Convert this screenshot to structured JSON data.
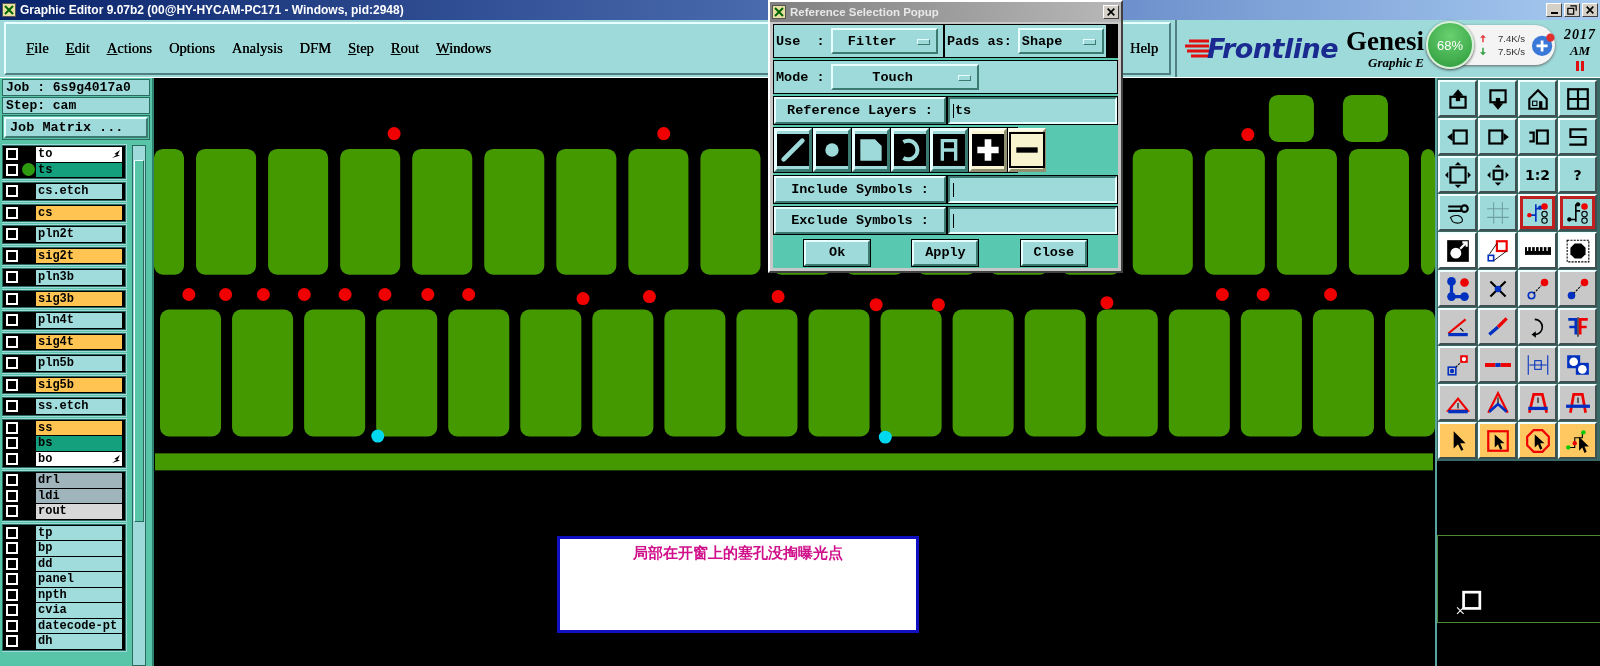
{
  "window": {
    "title": "Graphic Editor 9.07b2 (00@HY-HYCAM-PC171 - Windows, pid:2948)"
  },
  "menu": [
    {
      "label": "File",
      "mnemonic": true
    },
    {
      "label": "Edit",
      "mnemonic": true
    },
    {
      "label": "Actions",
      "mnemonic": true
    },
    {
      "label": "Options",
      "mnemonic": false
    },
    {
      "label": "Analysis",
      "mnemonic": false
    },
    {
      "label": "DFM",
      "mnemonic": false
    },
    {
      "label": "Step",
      "mnemonic": true
    },
    {
      "label": "Rout",
      "mnemonic": true
    },
    {
      "label": "Windows",
      "mnemonic": true
    }
  ],
  "help": "Help",
  "brand": {
    "logo": "Frontline",
    "product": "Genesi",
    "subtitle": "Graphic E",
    "year": "2017",
    "ampm": "AM"
  },
  "tray": {
    "percent": "68%",
    "upload": "7.4K/s",
    "download": "7.5K/s"
  },
  "job": "Job : 6s9g4017a0",
  "step": "Step: cam",
  "job_matrix": "Job Matrix ...",
  "layer_groups": [
    [
      {
        "name": "to",
        "color": "#ffffff",
        "checked": false,
        "work": false,
        "flag": true
      },
      {
        "name": "ts",
        "color": "#14a07c",
        "checked": false,
        "work": true,
        "flag": false
      }
    ],
    [
      {
        "name": "cs.etch",
        "color": "#a0dcdc",
        "checked": false,
        "work": false,
        "flag": false
      }
    ],
    [
      {
        "name": "cs",
        "color": "#ffc452",
        "checked": false,
        "work": false,
        "flag": false
      }
    ],
    [
      {
        "name": "pln2t",
        "color": "#a0dcdc",
        "checked": false,
        "work": false,
        "flag": false
      }
    ],
    [
      {
        "name": "sig2t",
        "color": "#ffc452",
        "checked": false,
        "work": false,
        "flag": false
      }
    ],
    [
      {
        "name": "pln3b",
        "color": "#a0dcdc",
        "checked": false,
        "work": false,
        "flag": false
      }
    ],
    [
      {
        "name": "sig3b",
        "color": "#ffc452",
        "checked": false,
        "work": false,
        "flag": false
      }
    ],
    [
      {
        "name": "pln4t",
        "color": "#a0dcdc",
        "checked": false,
        "work": false,
        "flag": false
      }
    ],
    [
      {
        "name": "sig4t",
        "color": "#ffc452",
        "checked": false,
        "work": false,
        "flag": false
      }
    ],
    [
      {
        "name": "pln5b",
        "color": "#a0dcdc",
        "checked": false,
        "work": false,
        "flag": false
      }
    ],
    [
      {
        "name": "sig5b",
        "color": "#ffc452",
        "checked": false,
        "work": false,
        "flag": false
      }
    ],
    [
      {
        "name": "ss.etch",
        "color": "#a0dcdc",
        "checked": false,
        "work": false,
        "flag": false
      }
    ],
    [
      {
        "name": "ss",
        "color": "#ffc452",
        "checked": false,
        "work": false,
        "flag": false
      },
      {
        "name": "bs",
        "color": "#14a07c",
        "checked": false,
        "work": false,
        "flag": false
      },
      {
        "name": "bo",
        "color": "#ffffff",
        "checked": false,
        "work": false,
        "flag": true
      }
    ],
    [
      {
        "name": "drl",
        "color": "#a0b4bc",
        "checked": false,
        "work": false,
        "flag": false
      },
      {
        "name": "ldi",
        "color": "#a0b4bc",
        "checked": false,
        "work": false,
        "flag": false
      },
      {
        "name": "rout",
        "color": "#d8d8d8",
        "checked": false,
        "work": false,
        "flag": false
      }
    ],
    [
      {
        "name": "tp",
        "color": "#a0dcdc",
        "checked": false,
        "work": false,
        "flag": false
      },
      {
        "name": "bp",
        "color": "#a0dcdc",
        "checked": false,
        "work": false,
        "flag": false
      },
      {
        "name": "dd",
        "color": "#a0dcdc",
        "checked": false,
        "work": false,
        "flag": false
      },
      {
        "name": "panel",
        "color": "#a0dcdc",
        "checked": false,
        "work": false,
        "flag": false
      },
      {
        "name": "npth",
        "color": "#a0dcdc",
        "checked": false,
        "work": false,
        "flag": false
      },
      {
        "name": "cvia",
        "color": "#a0dcdc",
        "checked": false,
        "work": false,
        "flag": false
      },
      {
        "name": "datecode-pt",
        "color": "#a0dcdc",
        "checked": false,
        "work": false,
        "flag": false
      },
      {
        "name": "dh",
        "color": "#a0dcdc",
        "checked": false,
        "work": false,
        "flag": false
      }
    ]
  ],
  "popup": {
    "title": "Reference Selection Popup",
    "use_label": "Use  :",
    "use_value": "Filter",
    "pads_label": "Pads as:",
    "pads_value": "Shape",
    "mode_label": "Mode :",
    "mode_value": "Touch",
    "ref_button": "Reference Layers :",
    "ref_value": "ts",
    "symbol_filters": [
      {
        "selected": false
      },
      {
        "selected": false
      },
      {
        "selected": false
      },
      {
        "selected": false
      },
      {
        "selected": false
      },
      {
        "selected": true
      },
      {
        "selected": true
      }
    ],
    "include_button": "Include Symbols :",
    "exclude_button": "Exclude Symbols :",
    "buttons": [
      "Ok",
      "Apply",
      "Close"
    ]
  },
  "toolbar": [
    {
      "color": "#9edada",
      "selected": false
    },
    {
      "color": "#9edada",
      "selected": false
    },
    {
      "color": "#9edada",
      "selected": false
    },
    {
      "color": "#9edada",
      "selected": false
    },
    {
      "color": "#9edada",
      "selected": false
    },
    {
      "color": "#9edada",
      "selected": false
    },
    {
      "color": "#9edada",
      "selected": false
    },
    {
      "color": "#9edada",
      "selected": false
    },
    {
      "color": "#9edada",
      "selected": false
    },
    {
      "color": "#9edada",
      "selected": false
    },
    {
      "color": "#9edada",
      "selected": false,
      "label": "1:2"
    },
    {
      "color": "#9edada",
      "selected": false,
      "label": "?"
    },
    {
      "color": "#9edada",
      "selected": false
    },
    {
      "color": "#9edada",
      "selected": false
    },
    {
      "color": "#9edada",
      "selected": true
    },
    {
      "color": "#9edada",
      "selected": true
    },
    {
      "color": "#ffffff",
      "selected": false
    },
    {
      "color": "#ffffff",
      "selected": false
    },
    {
      "color": "#ffffff",
      "selected": false
    },
    {
      "color": "#ffffff",
      "selected": false
    },
    {
      "color": "#c8c8c8",
      "selected": false
    },
    {
      "color": "#c8c8c8",
      "selected": false
    },
    {
      "color": "#c8c8c8",
      "selected": false
    },
    {
      "color": "#c8c8c8",
      "selected": false
    },
    {
      "color": "#c8c8c8",
      "selected": false
    },
    {
      "color": "#c8c8c8",
      "selected": false
    },
    {
      "color": "#c8c8c8",
      "selected": false
    },
    {
      "color": "#c8c8c8",
      "selected": false
    },
    {
      "color": "#c8c8c8",
      "selected": false
    },
    {
      "color": "#c8c8c8",
      "selected": false
    },
    {
      "color": "#c8c8c8",
      "selected": false
    },
    {
      "color": "#c8c8c8",
      "selected": false
    },
    {
      "color": "#c8c8c8",
      "selected": false
    },
    {
      "color": "#c8c8c8",
      "selected": false
    },
    {
      "color": "#c8c8c8",
      "selected": false
    },
    {
      "color": "#c8c8c8",
      "selected": false
    },
    {
      "color": "#ffc860",
      "selected": false
    },
    {
      "color": "#ffc860",
      "selected": false
    },
    {
      "color": "#ffc860",
      "selected": false
    },
    {
      "color": "#ffc860",
      "selected": false
    }
  ],
  "annotation": "局部在开窗上的塞孔没掏曝光点"
}
